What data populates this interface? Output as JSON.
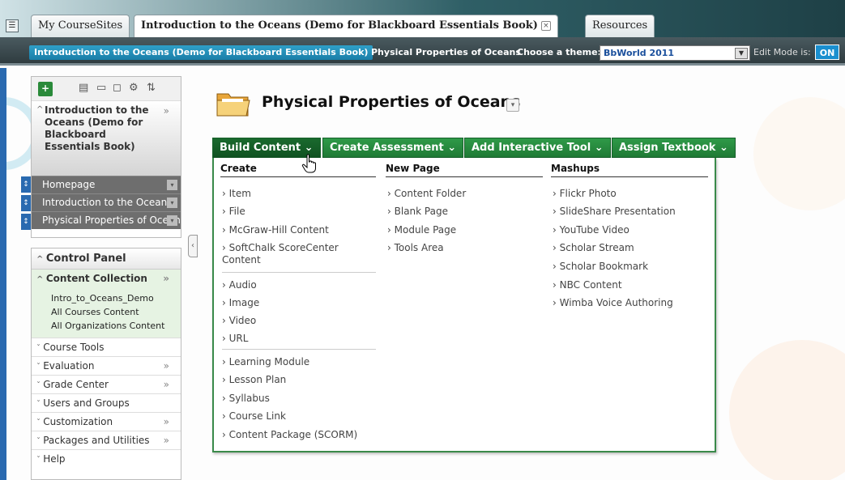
{
  "tabs": [
    {
      "label": "My CourseSites"
    },
    {
      "label": "Introduction to the Oceans (Demo for Blackboard Essentials Book)"
    },
    {
      "label": "Resources"
    }
  ],
  "breadcrumb": {
    "course": "Introduction to the Oceans (Demo for Blackboard Essentials Book)",
    "page": "Physical Properties of Oceans"
  },
  "theme": {
    "label": "Choose a theme:",
    "selected": "BbWorld 2011"
  },
  "edit_mode": {
    "label": "Edit Mode is:",
    "value": "ON"
  },
  "course_menu": {
    "title": "Introduction to the Oceans (Demo for Blackboard Essentials Book)",
    "items": [
      {
        "label": "Homepage"
      },
      {
        "label": "Introduction to the Oceans"
      },
      {
        "label": "Physical Properties of Oceans"
      }
    ]
  },
  "control_panel": {
    "title": "Control Panel",
    "content_collection": {
      "label": "Content Collection",
      "children": [
        "Intro_to_Oceans_Demo",
        "All Courses Content",
        "All Organizations Content"
      ]
    },
    "items": [
      {
        "label": "Course Tools"
      },
      {
        "label": "Evaluation"
      },
      {
        "label": "Grade Center"
      },
      {
        "label": "Users and Groups"
      },
      {
        "label": "Customization"
      },
      {
        "label": "Packages and Utilities"
      },
      {
        "label": "Help"
      }
    ]
  },
  "page_title": "Physical Properties of Oceans",
  "toolbar": {
    "build_content": "Build Content",
    "create_assessment": "Create Assessment",
    "add_interactive_tool": "Add Interactive Tool",
    "assign_textbook": "Assign Textbook"
  },
  "dropdown": {
    "create": {
      "title": "Create",
      "items": [
        "Item",
        "File",
        "McGraw-Hill Content",
        "SoftChalk ScoreCenter Content",
        "Audio",
        "Image",
        "Video",
        "URL",
        "Learning Module",
        "Lesson Plan",
        "Syllabus",
        "Course Link",
        "Content Package (SCORM)"
      ]
    },
    "new_page": {
      "title": "New Page",
      "items": [
        "Content Folder",
        "Blank Page",
        "Module Page",
        "Tools Area"
      ]
    },
    "mashups": {
      "title": "Mashups",
      "items": [
        "Flickr Photo",
        "SlideShare Presentation",
        "YouTube Video",
        "Scholar Stream",
        "Scholar Bookmark",
        "NBC Content",
        "Wimba Voice Authoring"
      ]
    }
  }
}
